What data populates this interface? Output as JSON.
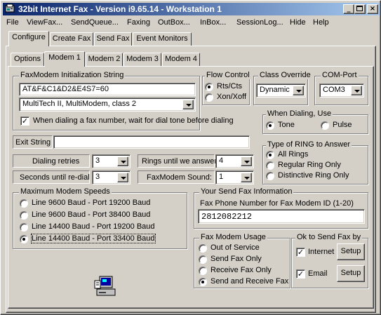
{
  "window": {
    "title": "32bit Internet Fax - Version i9.65.14 - Workstation 1",
    "min_icon": "minimize-icon",
    "max_icon": "maximize-icon",
    "close_icon": "close-icon"
  },
  "menu": [
    "File",
    "ViewFax...",
    "SendQueue...",
    "Faxing",
    "OutBox...",
    "InBox...",
    "SessionLog...",
    "Hide",
    "Help"
  ],
  "main_tabs": [
    "Configure",
    "Create Fax",
    "Send Fax",
    "Event Monitors"
  ],
  "sub_tabs": [
    "Options",
    "Modem 1",
    "Modem 2",
    "Modem 3",
    "Modem 4"
  ],
  "init": {
    "legend": "FaxModem Initialization String",
    "value": "AT&F&C1&D2&E4S7=60",
    "modem_type": "MultiTech II, MultiModem, class 2",
    "wait_dial_label": "When dialing a fax number, wait for dial tone before dialing",
    "wait_dial_checked": true
  },
  "flow": {
    "legend": "Flow Control",
    "options": [
      "Rts/Cts",
      "Xon/Xoff"
    ],
    "selected": 0
  },
  "class_override": {
    "legend": "Class Override",
    "value": "Dynamic"
  },
  "com_port": {
    "legend": "COM-Port",
    "value": "COM3"
  },
  "dialing": {
    "legend": "When Dialing, Use",
    "options": [
      "Tone",
      "Pulse"
    ],
    "selected": 0
  },
  "exit_string": {
    "label": "Exit String",
    "value": ""
  },
  "ring_type": {
    "legend": "Type of RING to Answer",
    "options": [
      "All Rings",
      "Regular Ring Only",
      "Distinctive Ring Only"
    ],
    "selected": 0
  },
  "fields": {
    "dialing_retries_label": "Dialing retries",
    "dialing_retries": "3",
    "seconds_redial_label": "Seconds until re-dial",
    "seconds_redial": "3",
    "rings_label": "Rings until we answer",
    "rings": "4",
    "sound_label": "FaxModem Sound:",
    "sound": "1"
  },
  "speeds": {
    "legend": "Maximum Modem Speeds",
    "options": [
      "Line 9600 Baud - Port 19200 Baud",
      "Line 9600 Baud - Port 38400 Baud",
      "Line 14400 Baud - Port 19200 Baud",
      "Line 14400 Baud - Port 33400 Baud"
    ],
    "selected": 3
  },
  "send_info": {
    "legend": "Your Send Fax Information",
    "phone_label": "Fax Phone Number for Fax Modem ID (1-20)",
    "phone": "2812082212"
  },
  "usage": {
    "legend": "Fax Modem Usage",
    "options": [
      "Out of Service",
      "Send Fax Only",
      "Receive Fax Only",
      "Send and Receive Fax"
    ],
    "selected": 3
  },
  "ok_send": {
    "legend": "Ok to Send Fax by",
    "internet_label": "Internet",
    "internet_checked": true,
    "email_label": "Email",
    "email_checked": true,
    "setup_label": "Setup"
  },
  "icons": {
    "app": "fax-app-icon",
    "computer": "computer-icon"
  }
}
